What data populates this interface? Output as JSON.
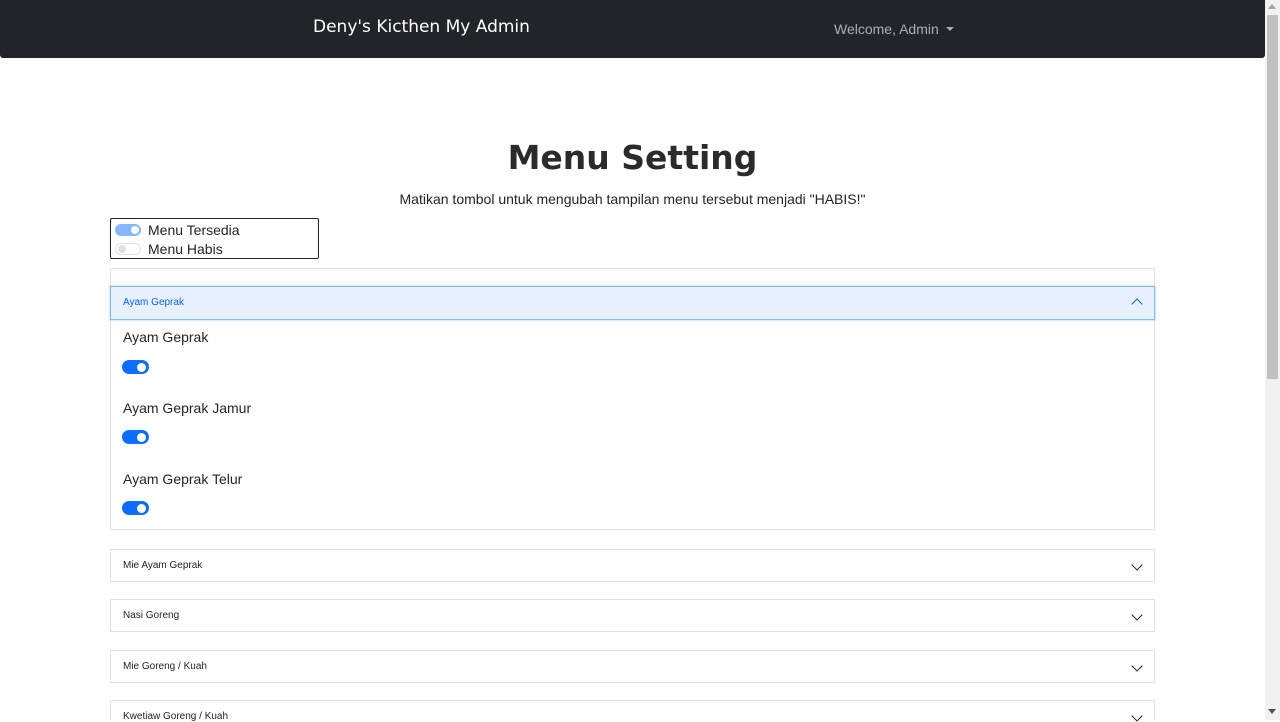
{
  "navbar": {
    "brand": "Deny's Kicthen My Admin",
    "user_menu": "Welcome, Admin"
  },
  "page": {
    "title": "Menu Setting",
    "subtitle": "Matikan tombol untuk mengubah tampilan menu tersebut menjadi \"HABIS!\""
  },
  "legend": {
    "available_label": "Menu Tersedia",
    "soldout_label": "Menu Habis"
  },
  "categories": [
    {
      "name": "Ayam Geprak",
      "expanded": true,
      "items": [
        {
          "name": "Ayam Geprak",
          "available": true
        },
        {
          "name": "Ayam Geprak Jamur",
          "available": true
        },
        {
          "name": "Ayam Geprak Telur",
          "available": true
        }
      ]
    },
    {
      "name": "Mie Ayam Geprak",
      "expanded": false
    },
    {
      "name": "Nasi Goreng",
      "expanded": false
    },
    {
      "name": "Mie Goreng / Kuah",
      "expanded": false
    },
    {
      "name": "Kwetiaw Goreng / Kuah",
      "expanded": false
    }
  ],
  "colors": {
    "navbar_bg": "#212529",
    "switch_on": "#0d6efd",
    "accordion_active_bg": "#e7f1ff",
    "accordion_active_text": "#0c63e4"
  },
  "icons": {
    "user_menu": "caret-down-icon",
    "expanded": "chevron-up-icon",
    "collapsed": "chevron-down-icon"
  }
}
